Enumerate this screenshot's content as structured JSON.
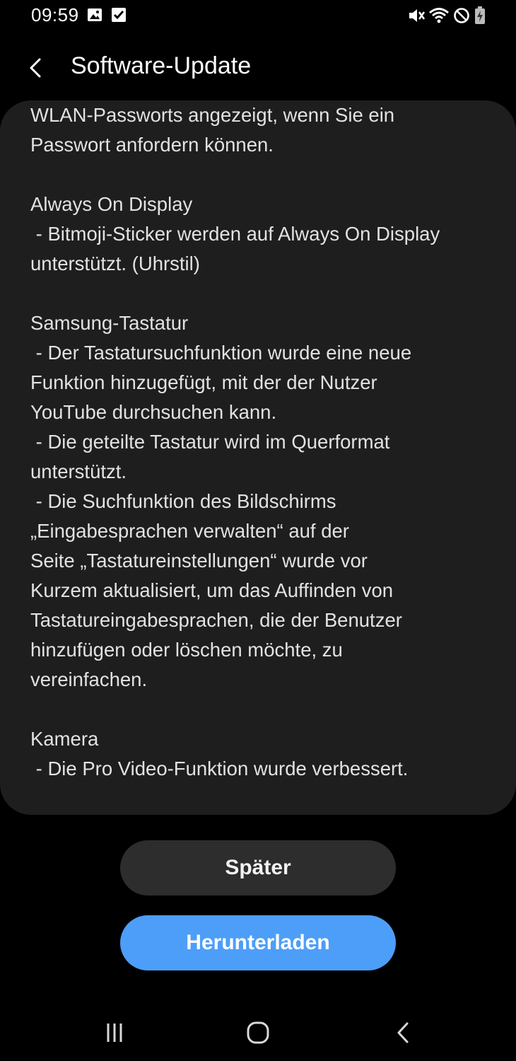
{
  "status_bar": {
    "time": "09:59",
    "left_icons": [
      "image-icon",
      "checkbox-icon"
    ],
    "right_icons": [
      "mute-icon",
      "wifi-icon",
      "do-not-disturb-icon",
      "battery-charging-icon"
    ]
  },
  "header": {
    "title": "Software-Update",
    "back_icon": "back-arrow-icon"
  },
  "release_notes": {
    "lines": [
      "WLAN-Passworts angezeigt, wenn Sie ein",
      "Passwort anfordern können.",
      "",
      "Always On Display",
      " - Bitmoji-Sticker werden auf Always On Display",
      "unterstützt. (Uhrstil)",
      "",
      "Samsung-Tastatur",
      " - Der Tastatursuchfunktion wurde eine neue",
      "Funktion hinzugefügt, mit der der Nutzer",
      "YouTube durchsuchen kann.",
      " - Die geteilte Tastatur wird im Querformat",
      "unterstützt.",
      " - Die Suchfunktion des Bildschirms",
      "„Eingabesprachen verwalten“ auf der",
      "Seite „Tastatureinstellungen“ wurde vor",
      "Kurzem aktualisiert, um das Auffinden von",
      "Tastatureingabesprachen, die der Benutzer",
      "hinzufügen oder löschen möchte, zu",
      "vereinfachen.",
      "",
      "Kamera",
      " - Die Pro Video-Funktion wurde verbessert."
    ]
  },
  "buttons": {
    "later_label": "Später",
    "download_label": "Herunterladen"
  },
  "nav_bar": {
    "icons": [
      "recent-apps-icon",
      "home-icon",
      "back-icon"
    ]
  },
  "colors": {
    "background": "#000000",
    "card": "#1e1e1e",
    "secondary_button": "#2d2d2d",
    "accent": "#4d9ef8"
  }
}
